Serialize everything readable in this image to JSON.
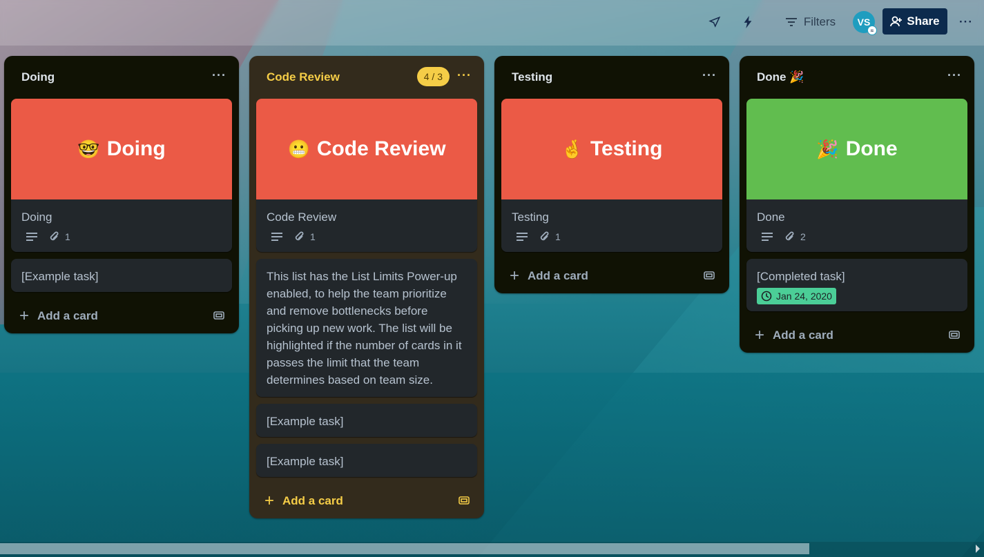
{
  "topbar": {
    "filters_label": "Filters",
    "avatar_initials": "VS",
    "share_label": "Share",
    "more_label": "···"
  },
  "lists": [
    {
      "title": "Doing",
      "menu": "···",
      "cover_card": {
        "cover_emoji": "🤓",
        "cover_text": "Doing",
        "cover_color": "#eb5a46",
        "title": "Doing",
        "attachments": "1"
      },
      "cards": [
        {
          "title": "[Example task]"
        }
      ],
      "add_card": "Add a card"
    },
    {
      "title": "Code Review",
      "menu": "···",
      "limit": "4 / 3",
      "cover_card": {
        "cover_emoji": "😬",
        "cover_text": "Code Review",
        "cover_color": "#eb5a46",
        "title": "Code Review",
        "attachments": "1"
      },
      "cards": [
        {
          "title": "This list has the List Limits Power-up enabled, to help the team prioritize and remove bottlenecks before picking up new work. The list will be highlighted if the number of cards in it passes the limit that the team determines based on team size."
        },
        {
          "title": "[Example task]"
        },
        {
          "title": "[Example task]"
        }
      ],
      "add_card": "Add a card"
    },
    {
      "title": "Testing",
      "menu": "···",
      "cover_card": {
        "cover_emoji": "🤞",
        "cover_text": "Testing",
        "cover_color": "#eb5a46",
        "title": "Testing",
        "attachments": "1"
      },
      "cards": [],
      "add_card": "Add a card"
    },
    {
      "title": "Done 🎉",
      "menu": "···",
      "cover_card": {
        "cover_emoji": "🎉",
        "cover_text": "Done",
        "cover_color": "#61bd4f",
        "title": "Done",
        "attachments": "2"
      },
      "cards": [
        {
          "title": "[Completed task]",
          "date": "Jan 24, 2020"
        }
      ],
      "add_card": "Add a card"
    }
  ],
  "colors": {
    "list_bg": "#101204",
    "list_highlight_bg": "#332b1c",
    "card_bg": "#22272b",
    "limit_yellow": "#f5cd47",
    "share_bg": "#0c2a4d",
    "date_badge": "#4bce97"
  }
}
